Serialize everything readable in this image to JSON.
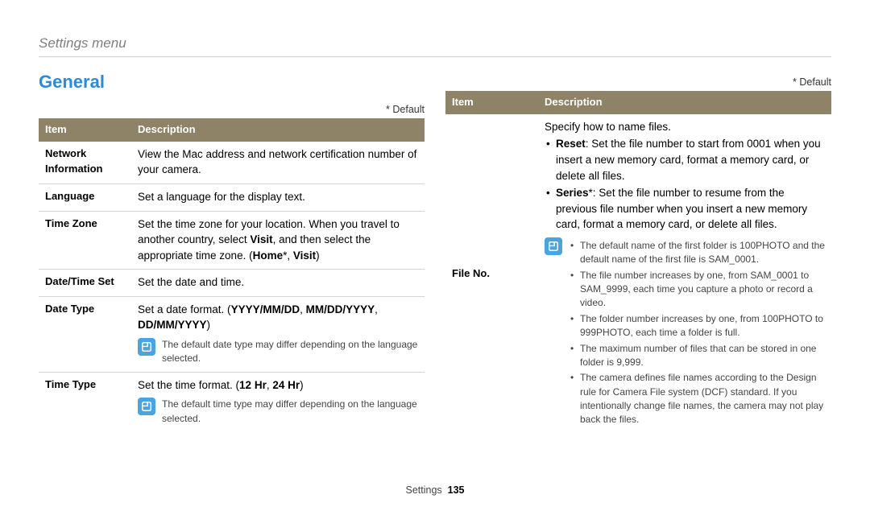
{
  "breadcrumb": "Settings menu",
  "section_title": "General",
  "default_label": "* Default",
  "headers": {
    "item": "Item",
    "desc": "Description"
  },
  "left": [
    {
      "item": "Network Information",
      "desc": "View the Mac address and network certification number of your camera."
    },
    {
      "item": "Language",
      "desc": "Set a language for the display text."
    },
    {
      "item": "Time Zone",
      "desc_html": "Set the time zone for your location. When you travel to another country, select <b>Visit</b>, and then select the appropriate time zone. (<b>Home</b>*, <b>Visit</b>)"
    },
    {
      "item": "Date/Time Set",
      "desc": "Set the date and time."
    },
    {
      "item": "Date Type",
      "desc_html": "Set a date format. (<b>YYYY/MM/DD</b>, <b>MM/DD/YYYY</b>, <b>DD/MM/YYYY</b>)",
      "note": "The default date type may differ depending on the language selected."
    },
    {
      "item": "Time Type",
      "desc_html": "Set the time format. (<b>12 Hr</b>, <b>24 Hr</b>)",
      "note": "The default time type may differ depending on the language selected."
    }
  ],
  "right": {
    "item": "File No.",
    "intro": "Specify how to name files.",
    "bullets": [
      "<b>Reset</b>: Set the file number to start from 0001 when you insert a new memory card, format a memory card, or delete all files.",
      "<b>Series</b>*: Set the file number to resume from the previous file number when you insert a new memory card, format a memory card, or delete all files."
    ],
    "notes": [
      "The default name of the first folder is 100PHOTO and the default name of the first file is SAM_0001.",
      "The file number increases by one, from SAM_0001 to SAM_9999, each time you capture a photo or record a video.",
      "The folder number increases by one, from 100PHOTO to 999PHOTO, each time a folder is full.",
      "The maximum number of files that can be stored in one folder is 9,999.",
      "The camera defines file names according to the Design rule for Camera File system (DCF) standard. If you intentionally change file names, the camera may not play back the files."
    ]
  },
  "footer": {
    "section": "Settings",
    "page": "135"
  }
}
